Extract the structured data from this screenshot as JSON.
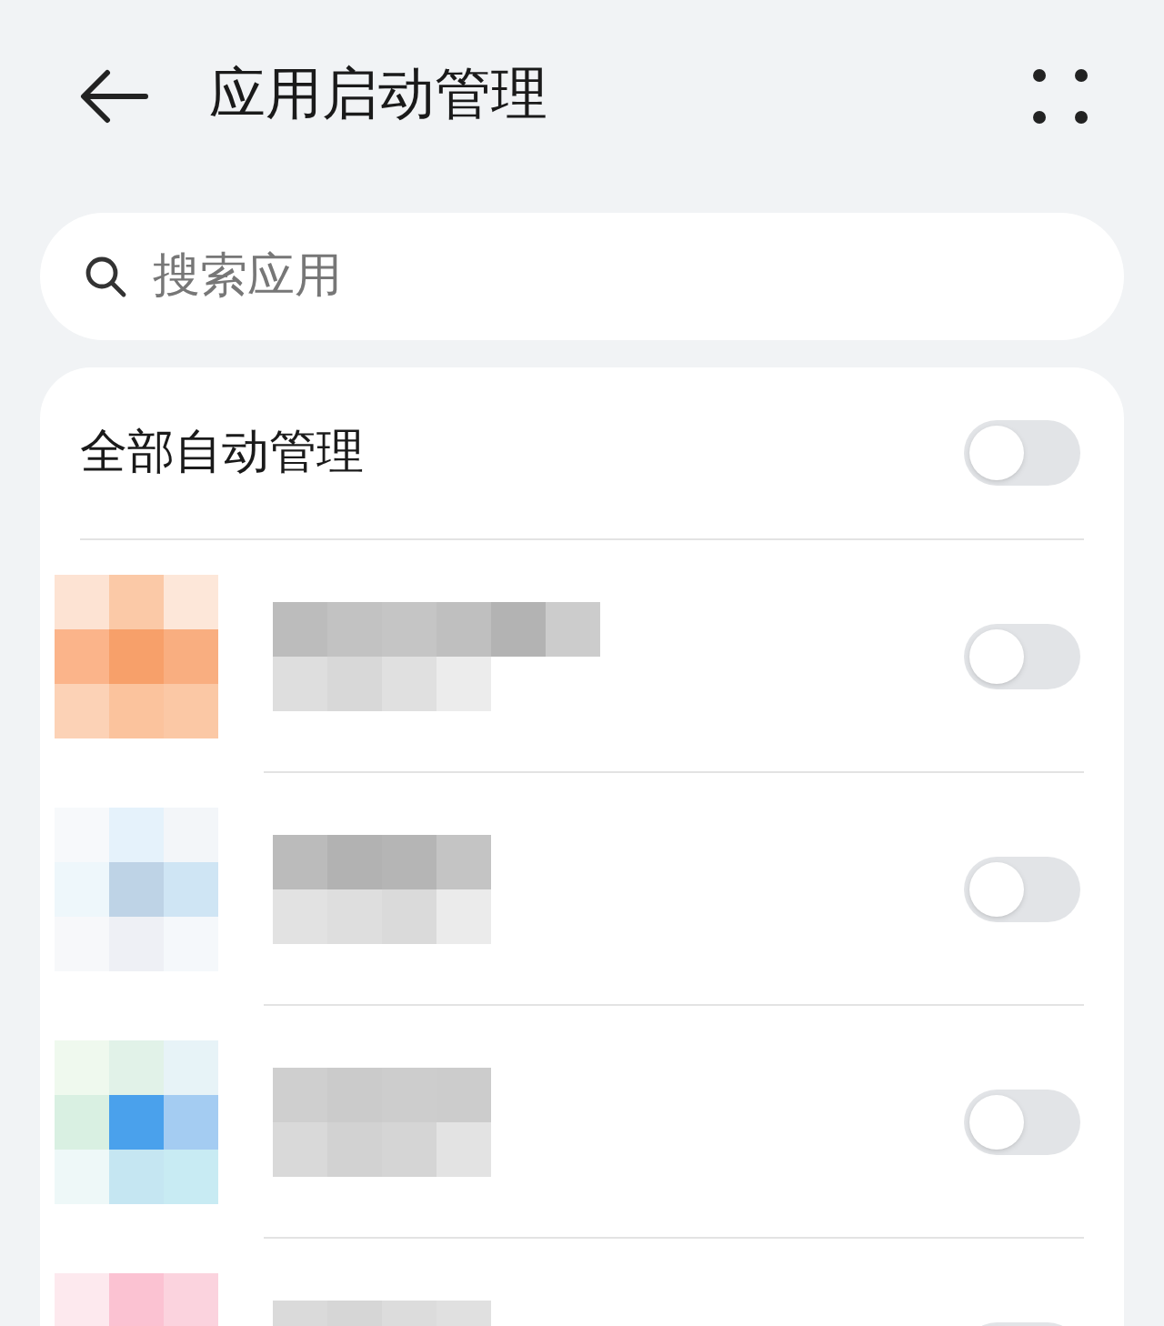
{
  "header": {
    "title": "应用启动管理"
  },
  "search": {
    "placeholder": "搜索应用"
  },
  "all_auto": {
    "label": "全部自动管理",
    "on": false
  },
  "apps": [
    {
      "on": false
    },
    {
      "on": false
    },
    {
      "on": false
    },
    {
      "on": false
    }
  ]
}
